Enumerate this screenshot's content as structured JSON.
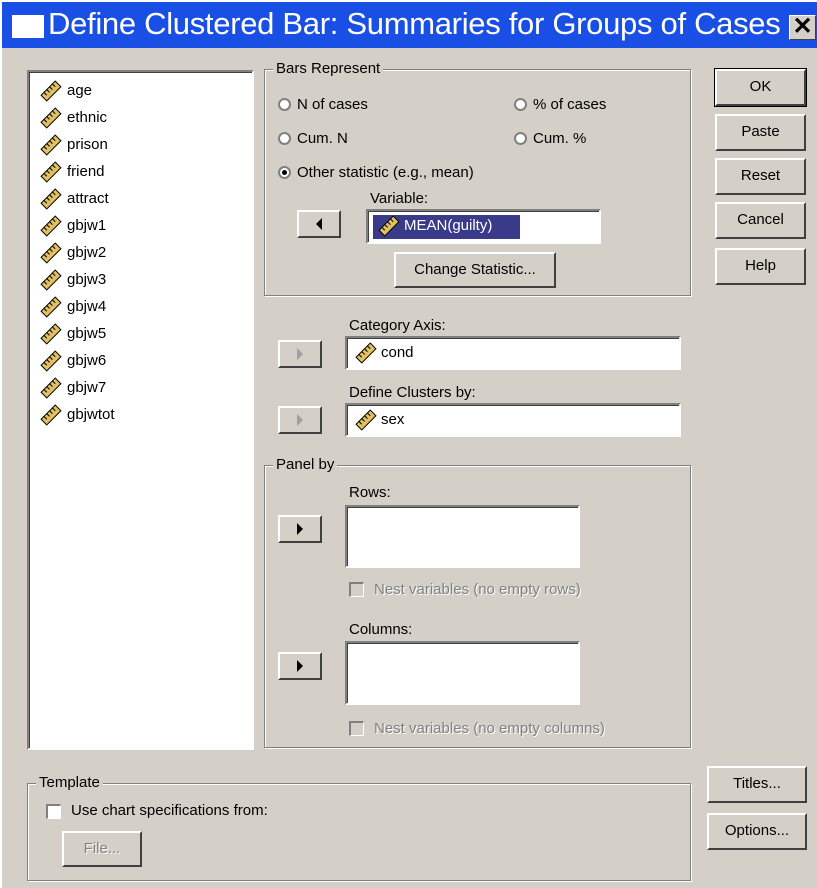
{
  "window": {
    "title": "Define Clustered Bar: Summaries for Groups of Cases",
    "close_glyph": "✕"
  },
  "variables": [
    {
      "label": "age",
      "icon": "ruler-scale-icon"
    },
    {
      "label": "ethnic",
      "icon": "ruler-scale-icon"
    },
    {
      "label": "prison",
      "icon": "ruler-scale-icon"
    },
    {
      "label": "friend",
      "icon": "ruler-scale-icon"
    },
    {
      "label": "attract",
      "icon": "ruler-scale-icon"
    },
    {
      "label": "gbjw1",
      "icon": "ruler-scale-icon"
    },
    {
      "label": "gbjw2",
      "icon": "ruler-scale-icon"
    },
    {
      "label": "gbjw3",
      "icon": "ruler-scale-icon"
    },
    {
      "label": "gbjw4",
      "icon": "ruler-scale-icon"
    },
    {
      "label": "gbjw5",
      "icon": "ruler-scale-icon"
    },
    {
      "label": "gbjw6",
      "icon": "ruler-scale-icon"
    },
    {
      "label": "gbjw7",
      "icon": "ruler-scale-icon"
    },
    {
      "label": "gbjwtot",
      "icon": "ruler-scale-icon"
    }
  ],
  "bars_represent": {
    "title": "Bars Represent",
    "options": [
      {
        "label": "N of cases",
        "selected": false
      },
      {
        "label": "% of cases",
        "selected": false
      },
      {
        "label": "Cum. N",
        "selected": false
      },
      {
        "label": "Cum. %",
        "selected": false
      },
      {
        "label": "Other statistic (e.g., mean)",
        "selected": true
      }
    ],
    "variable_label": "Variable:",
    "variable_value": "MEAN(guilty)",
    "change_statistic": "Change Statistic..."
  },
  "category_axis": {
    "label": "Category Axis:",
    "value": "cond"
  },
  "define_clusters": {
    "label": "Define Clusters by:",
    "value": "sex"
  },
  "panel_by": {
    "title": "Panel by",
    "rows_label": "Rows:",
    "nest_rows": "Nest variables (no empty rows)",
    "columns_label": "Columns:",
    "nest_columns": "Nest variables (no empty columns)"
  },
  "template": {
    "title": "Template",
    "use_spec": "Use chart specifications from:",
    "file_button": "File..."
  },
  "buttons": {
    "ok": "OK",
    "paste": "Paste",
    "reset": "Reset",
    "cancel": "Cancel",
    "help": "Help",
    "titles": "Titles...",
    "options": "Options..."
  },
  "colors": {
    "titlebar": "#1a4fe6",
    "dialog": "#d4d0c8"
  }
}
